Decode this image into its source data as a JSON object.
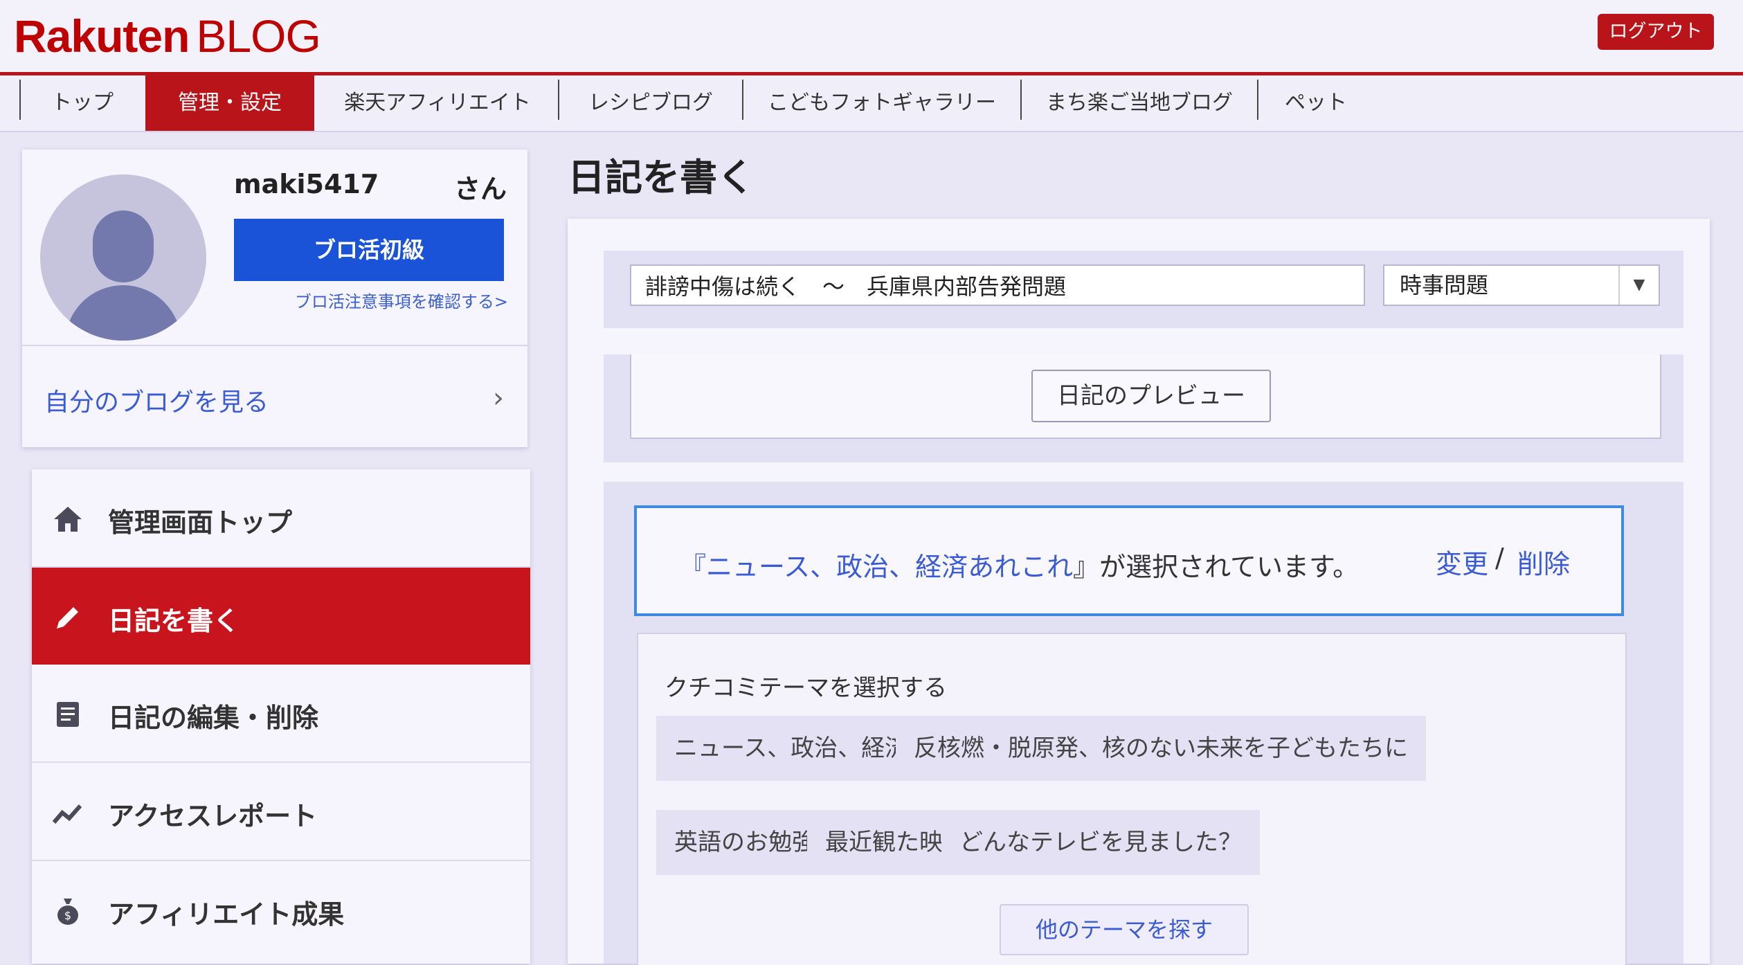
{
  "header": {
    "logo_main": "Rakuten",
    "logo_sub": "BLOG",
    "logout_label": "ログアウト"
  },
  "nav": {
    "items": [
      {
        "label": "トップ"
      },
      {
        "label": "管理・設定",
        "active": true
      },
      {
        "label": "楽天アフィリエイト"
      },
      {
        "label": "レシピブログ"
      },
      {
        "label": "こどもフォトギャラリー"
      },
      {
        "label": "まち楽ご当地ブログ"
      },
      {
        "label": "ペット"
      }
    ]
  },
  "profile": {
    "username": "maki5417",
    "honorific": "さん",
    "rank_label": "ブロ活初級",
    "rank_notice_link": "ブロ活注意事項を確認する>",
    "my_blog_link": "自分のブログを見る",
    "chevron": "›"
  },
  "menu": {
    "items": [
      {
        "label": "管理画面トップ",
        "icon": "home-icon"
      },
      {
        "label": "日記を書く",
        "icon": "pencil-icon",
        "active": true
      },
      {
        "label": "日記の編集・削除",
        "icon": "document-icon"
      },
      {
        "label": "アクセスレポート",
        "icon": "trend-icon"
      },
      {
        "label": "アフィリエイト成果",
        "icon": "money-bag-icon"
      }
    ]
  },
  "main": {
    "page_title": "日記を書く",
    "title_input_value": "誹謗中傷は続く　～　兵庫県内部告発問題",
    "category_value": "時事問題",
    "preview_button": "日記のプレビュー",
    "selected_theme_prefix": "『",
    "selected_theme": "ニュース、政治、経済あれこれ",
    "selected_theme_suffix": "』が選択されています。",
    "change_link": "変更",
    "separator": "/",
    "delete_link": "削除",
    "theme_heading": "クチコミテーマを選択する",
    "themes": [
      "ニュース、政治、経済あれこれ",
      "反核燃・脱原発、核のない未来を子どもたちに",
      "英語のお勉強日記",
      "最近観た映画。",
      "どんなテレビを見ました？"
    ],
    "more_themes_button": "他のテーマを探す"
  },
  "colors": {
    "brand_red": "#bf0000",
    "active_red": "#c8141c",
    "link_blue": "#3a5bd4",
    "rank_blue": "#1b53d8",
    "selected_border": "#3d8ae0"
  }
}
